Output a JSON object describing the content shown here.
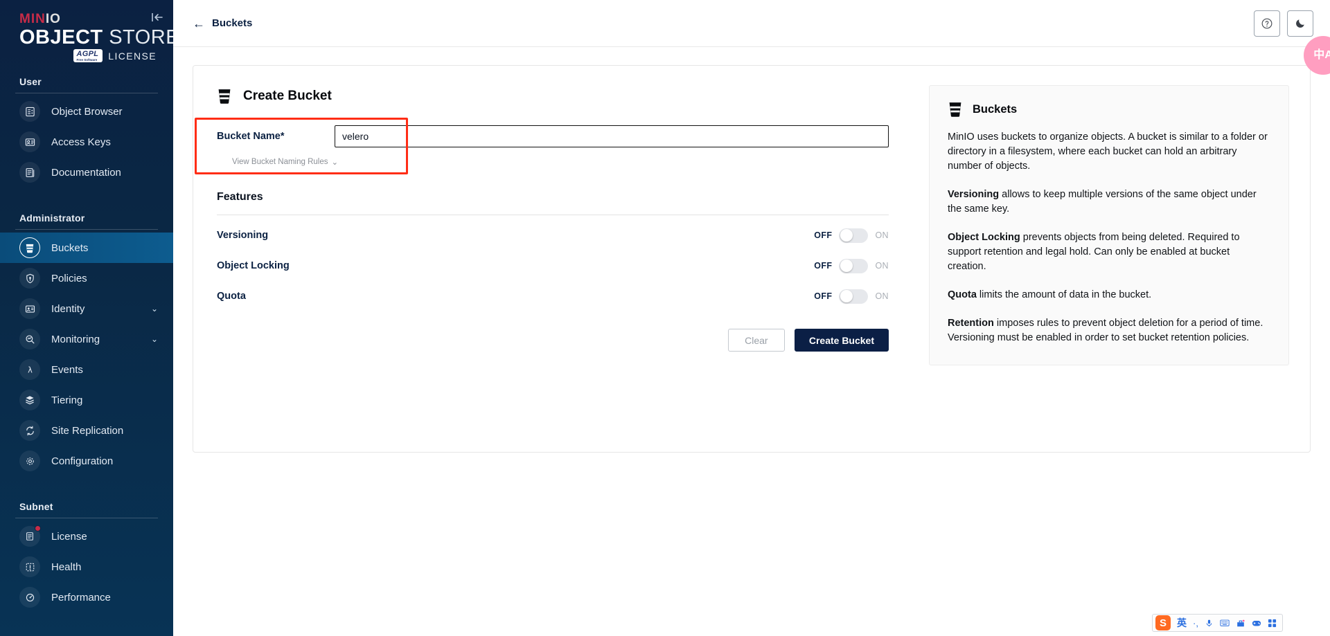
{
  "brand": {
    "minio": "MIN",
    "minio_io": "IO",
    "object": "OBJECT",
    "store": "STORE",
    "agpl": "AGPL",
    "agpl_sub": "Free Software",
    "license": "LICENSE",
    "collapse_icon": "collapse-sidebar-icon"
  },
  "sidebar": {
    "sections": [
      {
        "title": "User",
        "items": [
          {
            "label": "Object Browser",
            "icon": "object-browser-icon",
            "active": false,
            "chevron": false,
            "badge": false
          },
          {
            "label": "Access Keys",
            "icon": "access-keys-icon",
            "active": false,
            "chevron": false,
            "badge": false
          },
          {
            "label": "Documentation",
            "icon": "documentation-icon",
            "active": false,
            "chevron": false,
            "badge": false
          }
        ]
      },
      {
        "title": "Administrator",
        "items": [
          {
            "label": "Buckets",
            "icon": "bucket-icon",
            "active": true,
            "chevron": false,
            "badge": false
          },
          {
            "label": "Policies",
            "icon": "policies-icon",
            "active": false,
            "chevron": false,
            "badge": false
          },
          {
            "label": "Identity",
            "icon": "identity-icon",
            "active": false,
            "chevron": true,
            "badge": false
          },
          {
            "label": "Monitoring",
            "icon": "monitoring-icon",
            "active": false,
            "chevron": true,
            "badge": false
          },
          {
            "label": "Events",
            "icon": "events-lambda-icon",
            "active": false,
            "chevron": false,
            "badge": false
          },
          {
            "label": "Tiering",
            "icon": "tiering-layers-icon",
            "active": false,
            "chevron": false,
            "badge": false
          },
          {
            "label": "Site Replication",
            "icon": "site-replication-icon",
            "active": false,
            "chevron": false,
            "badge": false
          },
          {
            "label": "Configuration",
            "icon": "configuration-gear-icon",
            "active": false,
            "chevron": false,
            "badge": false
          }
        ]
      },
      {
        "title": "Subnet",
        "items": [
          {
            "label": "License",
            "icon": "license-icon",
            "active": false,
            "chevron": false,
            "badge": true
          },
          {
            "label": "Health",
            "icon": "health-icon",
            "active": false,
            "chevron": false,
            "badge": false
          },
          {
            "label": "Performance",
            "icon": "performance-icon",
            "active": false,
            "chevron": false,
            "badge": false
          }
        ]
      }
    ]
  },
  "topbar": {
    "back_label": "Buckets",
    "back_icon": "arrow-left-icon",
    "help_icon": "help-circle-icon",
    "dark_mode_icon": "moon-icon"
  },
  "form": {
    "title": "Create Bucket",
    "title_icon": "bucket-icon",
    "bucket_name_label": "Bucket Name*",
    "bucket_name_value": "velero",
    "bucket_name_placeholder": "",
    "naming_rules_label": "View Bucket Naming Rules",
    "naming_rules_chevron": "chevron-down-icon",
    "features_heading": "Features",
    "toggles": [
      {
        "label": "Versioning",
        "off_label": "OFF",
        "on_label": "ON",
        "state": "off"
      },
      {
        "label": "Object Locking",
        "off_label": "OFF",
        "on_label": "ON",
        "state": "off"
      },
      {
        "label": "Quota",
        "off_label": "OFF",
        "on_label": "ON",
        "state": "off"
      }
    ],
    "clear_label": "Clear",
    "submit_label": "Create Bucket"
  },
  "info": {
    "title": "Buckets",
    "title_icon": "bucket-icon",
    "paragraphs": [
      {
        "lead": "",
        "text": "MinIO uses buckets to organize objects. A bucket is similar to a folder or directory in a filesystem, where each bucket can hold an arbitrary number of objects."
      },
      {
        "lead": "Versioning",
        "text": " allows to keep multiple versions of the same object under the same key."
      },
      {
        "lead": "Object Locking",
        "text": " prevents objects from being deleted. Required to support retention and legal hold. Can only be enabled at bucket creation."
      },
      {
        "lead": "Quota",
        "text": " limits the amount of data in the bucket."
      },
      {
        "lead": "Retention",
        "text": " imposes rules to prevent object deletion for a period of time. Versioning must be enabled in order to set bucket retention policies."
      }
    ]
  },
  "ime": {
    "bubble_label": "中A",
    "logo_label": "S",
    "items": [
      "英",
      "·,",
      "mic-icon",
      "keyboard-icon",
      "toolbox-icon",
      "game-icon",
      "apps-icon"
    ]
  },
  "colors": {
    "sidebar_top": "#0b2142",
    "sidebar_bottom": "#083355",
    "active_nav": "#0d5c8f",
    "brand_red": "#c72c48",
    "primary_button": "#0b1f45",
    "highlight_red": "#ff2d16",
    "ime_pink": "#ff9ec0"
  }
}
